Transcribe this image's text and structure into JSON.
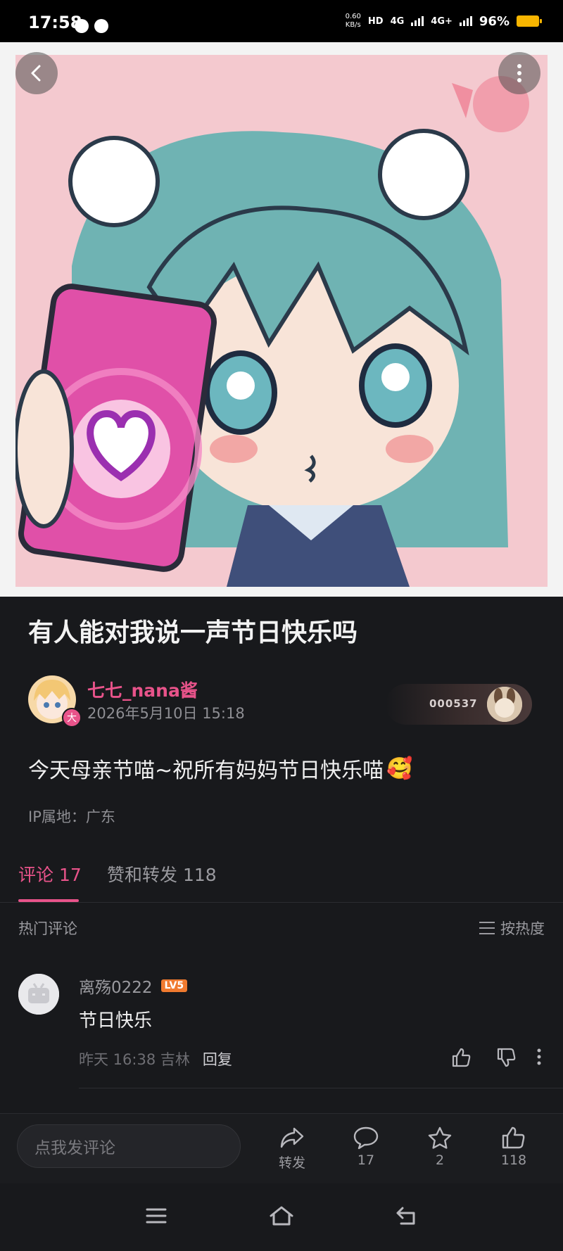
{
  "status_bar": {
    "time": "17:58",
    "net_speed_value": "0.60",
    "net_speed_unit": "KB/s",
    "hd": "HD",
    "sig1": "4G",
    "sig2": "4G+",
    "battery": "96%",
    "battery_color": "#f7b500"
  },
  "post": {
    "title": "有人能对我说一声节日快乐吗",
    "author": "七七_nana酱",
    "author_badge": "大",
    "date": "2026年5月10日 15:18",
    "fan_number": "000537",
    "content": "今天母亲节喵~祝所有妈妈节日快乐喵",
    "content_emoji": "🥰",
    "ip": "IP属地：广东"
  },
  "tabs": [
    {
      "label": "评论 17"
    },
    {
      "label": "赞和转发 118"
    }
  ],
  "comments_header": {
    "hot": "热门评论",
    "sort": "按热度"
  },
  "comment": {
    "user": "离殇0222",
    "level": "LV5",
    "text": "节日快乐",
    "meta": "昨天 16:38 吉林",
    "reply": "回复"
  },
  "bottom_bar": {
    "placeholder": "点我发评论",
    "share_label": "转发",
    "comment_count": "17",
    "favorite_count": "2",
    "like_count": "118"
  },
  "colors": {
    "accent": "#e8538a",
    "background": "#18191c",
    "level_badge": "#f07a2f"
  }
}
